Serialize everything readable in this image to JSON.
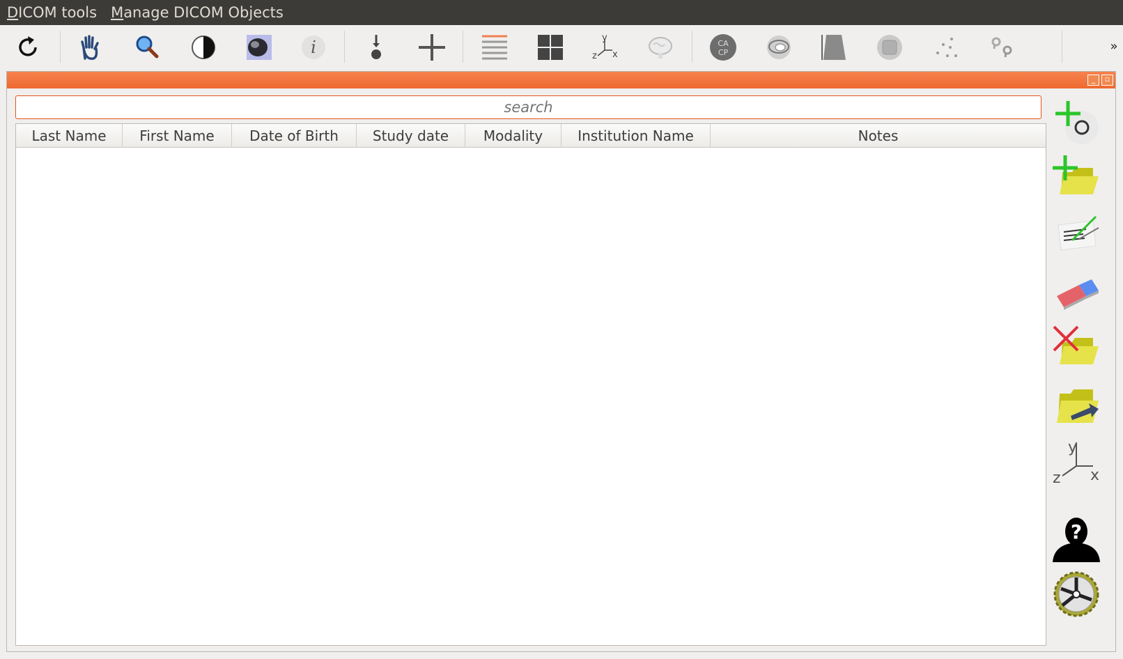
{
  "menubar": {
    "items": [
      {
        "mnemonic": "D",
        "rest": "ICOM tools"
      },
      {
        "mnemonic": "M",
        "rest": "anage DICOM Objects"
      }
    ]
  },
  "toolbar": {
    "icons": [
      "rotate-icon",
      "pan-hand-icon",
      "zoom-icon",
      "contrast-icon",
      "skull-render-icon",
      "info-icon",
      "plumb-icon",
      "crosshair-icon",
      "slices-stack-icon",
      "grid-layout-icon",
      "axes-xyz-icon",
      "brain-icon",
      "ca-cp-icon",
      "head-3d-icon",
      "trapezoid-icon",
      "rounded-square-icon",
      "dots-icon",
      "markers-icon"
    ],
    "axes_label": {
      "y": "y",
      "z": "z",
      "x": "x"
    },
    "cacp_label": {
      "top": "CA",
      "bottom": "CP"
    },
    "info_label": "i",
    "overflow_label": "»"
  },
  "dock": {
    "minimize_label": "_",
    "float_label": "▫"
  },
  "search": {
    "placeholder": "search"
  },
  "table": {
    "columns": [
      "Last Name",
      "First Name",
      "Date of Birth",
      "Study date",
      "Modality",
      "Institution Name",
      "Notes"
    ],
    "rows": []
  },
  "side_panel": {
    "icons": [
      "add-object-icon",
      "add-folder-icon",
      "edit-notes-icon",
      "eraser-icon",
      "delete-folder-icon",
      "export-folder-icon",
      "axes-icon",
      "unknown-person-icon",
      "settings-gear-icon"
    ],
    "axes_label": {
      "y": "y",
      "z": "z",
      "x": "x"
    },
    "person_label": "?"
  },
  "colors": {
    "menubar_bg": "#3c3b37",
    "dock_title": "#ee6a30",
    "search_border": "#e5531b"
  }
}
